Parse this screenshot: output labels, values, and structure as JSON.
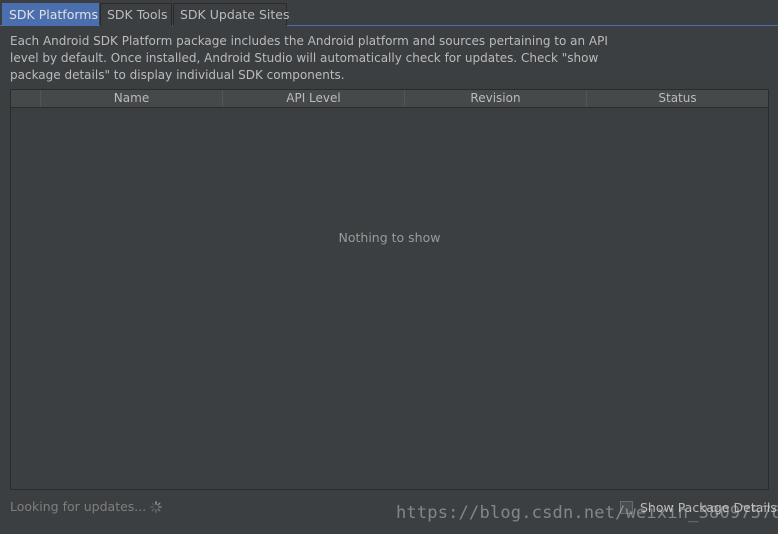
{
  "tabs": [
    {
      "label": "SDK Platforms",
      "active": true
    },
    {
      "label": "SDK Tools",
      "active": false
    },
    {
      "label": "SDK Update Sites",
      "active": false
    }
  ],
  "description": "Each Android SDK Platform package includes the Android platform and sources pertaining to an API level by default. Once installed, Android Studio will automatically check for updates. Check \"show package details\" to display individual SDK components.",
  "table": {
    "columns": [
      "",
      "Name",
      "API Level",
      "Revision",
      "Status"
    ],
    "empty_text": "Nothing to show"
  },
  "footer": {
    "status_text": "Looking for updates...",
    "show_details_label": "Show Package Details",
    "show_details_checked": false
  },
  "watermark": "https://blog.csdn.net/weixin_38097576",
  "colors": {
    "background": "#3c3f41",
    "active_tab": "#4b6eaf",
    "text": "#bbbbbb"
  }
}
